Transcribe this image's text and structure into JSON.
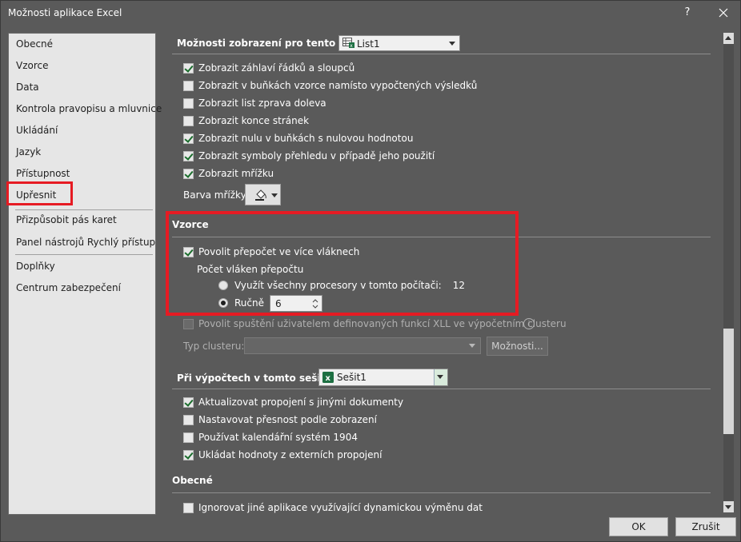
{
  "window": {
    "title": "Možnosti aplikace Excel",
    "help_label": "?"
  },
  "sidebar": {
    "items": [
      {
        "label": "Obecné"
      },
      {
        "label": "Vzorce"
      },
      {
        "label": "Data"
      },
      {
        "label": "Kontrola pravopisu a mluvnice"
      },
      {
        "label": "Ukládání"
      },
      {
        "label": "Jazyk"
      },
      {
        "label": "Přístupnost"
      },
      {
        "label": "Upřesnit"
      },
      {
        "label": "Přizpůsobit pás karet"
      },
      {
        "label": "Panel nástrojů Rychlý přístup"
      },
      {
        "label": "Doplňky"
      },
      {
        "label": "Centrum zabezpečení"
      }
    ],
    "selected": "Upřesnit"
  },
  "display_sheet": {
    "heading": "Možnosti zobrazení pro tento list:",
    "sheet_value": "List1",
    "options": [
      {
        "label": "Zobrazit záhlaví řádků a sloupců",
        "checked": true
      },
      {
        "label": "Zobrazit v buňkách vzorce namísto vypočtených výsledků",
        "checked": false
      },
      {
        "label": "Zobrazit list zprava doleva",
        "checked": false
      },
      {
        "label": "Zobrazit konce stránek",
        "checked": false
      },
      {
        "label": "Zobrazit nulu v buňkách s nulovou hodnotou",
        "checked": true
      },
      {
        "label": "Zobrazit symboly přehledu v případě jeho použití",
        "checked": true
      },
      {
        "label": "Zobrazit mřížku",
        "checked": true
      }
    ],
    "grid_color_label": "Barva mřížky"
  },
  "formulas": {
    "heading": "Vzorce",
    "multithread_label": "Povolit přepočet ve více vláknech",
    "multithread_checked": true,
    "threads_label": "Počet vláken přepočtu",
    "all_processors_label": "Využít všechny procesory v tomto počítači:",
    "processor_count": "12",
    "manual_label": "Ručně",
    "manual_value": "6",
    "xll_label": "Povolit spuštění uživatelem definovaných funkcí XLL ve výpočetním clusteru",
    "cluster_type_label": "Typ clusteru:",
    "options_button": "Možnosti..."
  },
  "workbook_calc": {
    "heading": "Při výpočtech v tomto sešitu:",
    "workbook_value": "Sešit1",
    "options": [
      {
        "label": "Aktualizovat propojení s jinými dokumenty",
        "checked": true
      },
      {
        "label": "Nastavovat přesnost podle zobrazení",
        "checked": false
      },
      {
        "label": "Používat kalendářní systém 1904",
        "checked": false
      },
      {
        "label": "Ukládat hodnoty z externích propojení",
        "checked": true
      }
    ]
  },
  "general": {
    "heading": "Obecné",
    "options": [
      {
        "label": "Ignorovat jiné aplikace využívající dynamickou výměnu dat",
        "checked": false
      }
    ]
  },
  "footer": {
    "ok": "OK",
    "cancel": "Zrušit"
  },
  "colors": {
    "highlight": "#e61b23",
    "background": "#5a5a5a",
    "check": "#1a6d2c"
  }
}
